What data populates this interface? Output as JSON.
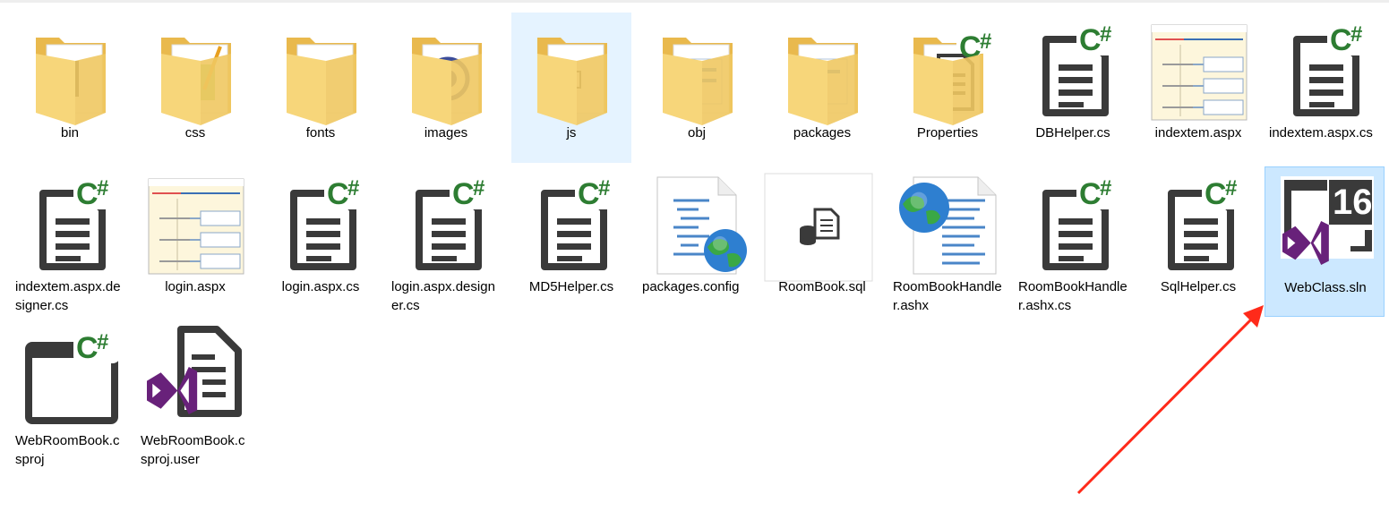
{
  "files": [
    {
      "name": "bin",
      "kind": "folder",
      "icon": "folder-bin-icon"
    },
    {
      "name": "css",
      "kind": "folder",
      "icon": "folder-css-icon"
    },
    {
      "name": "fonts",
      "kind": "folder",
      "icon": "folder-fonts-icon"
    },
    {
      "name": "images",
      "kind": "folder",
      "icon": "folder-images-icon"
    },
    {
      "name": "js",
      "kind": "folder",
      "icon": "folder-js-icon"
    },
    {
      "name": "obj",
      "kind": "folder",
      "icon": "folder-obj-icon"
    },
    {
      "name": "packages",
      "kind": "folder",
      "icon": "folder-packages-icon"
    },
    {
      "name": "Properties",
      "kind": "folder",
      "icon": "folder-properties-icon"
    },
    {
      "name": "DBHelper.cs",
      "kind": "cs",
      "icon": "csharp-file-icon"
    },
    {
      "name": "indextem.aspx",
      "kind": "aspx",
      "icon": "aspx-page-icon"
    },
    {
      "name": "indextem.aspx.cs",
      "kind": "cs",
      "icon": "csharp-file-icon"
    },
    {
      "name": "indextem.aspx.designer.cs",
      "kind": "cs",
      "icon": "csharp-file-icon"
    },
    {
      "name": "login.aspx",
      "kind": "aspx",
      "icon": "aspx-page-icon"
    },
    {
      "name": "login.aspx.cs",
      "kind": "cs",
      "icon": "csharp-file-icon"
    },
    {
      "name": "login.aspx.designer.cs",
      "kind": "cs",
      "icon": "csharp-file-icon"
    },
    {
      "name": "MD5Helper.cs",
      "kind": "cs",
      "icon": "csharp-file-icon"
    },
    {
      "name": "packages.config",
      "kind": "config",
      "icon": "config-globe-icon"
    },
    {
      "name": "RoomBook.sql",
      "kind": "sql",
      "icon": "sql-file-icon"
    },
    {
      "name": "RoomBookHandler.ashx",
      "kind": "ashx",
      "icon": "ashx-globe-icon"
    },
    {
      "name": "RoomBookHandler.ashx.cs",
      "kind": "cs",
      "icon": "csharp-file-icon"
    },
    {
      "name": "SqlHelper.cs",
      "kind": "cs",
      "icon": "csharp-file-icon"
    },
    {
      "name": "WebClass.sln",
      "kind": "sln",
      "icon": "vs-solution-icon",
      "badge": "16"
    },
    {
      "name": "WebRoomBook.csproj",
      "kind": "csproj",
      "icon": "csharp-project-icon"
    },
    {
      "name": "WebRoomBook.csproj.user",
      "kind": "user",
      "icon": "vs-user-file-icon"
    }
  ],
  "hovered_item": "js",
  "selected_item": "WebClass.sln",
  "colors": {
    "selection": "#cce8ff",
    "hover": "#e5f3ff",
    "folder": "#f5cf6e",
    "csharp_green": "#2d7d32",
    "vs_purple": "#68217a",
    "arrow": "#ff2a1a"
  }
}
